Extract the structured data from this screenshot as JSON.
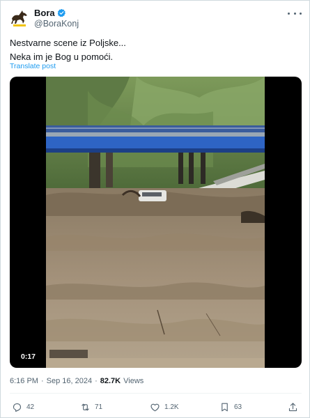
{
  "author": {
    "display_name": "Bora",
    "handle": "@BoraKonj",
    "verified": true,
    "avatar_icon": "horse-icon",
    "verified_icon": "verified-badge-icon"
  },
  "tweet": {
    "lines": [
      "Nestvarne scene iz Poljske...",
      "Neka im je Bog u pomoći."
    ],
    "translate_label": "Translate post"
  },
  "media": {
    "duration": "0:17"
  },
  "meta": {
    "time": "6:16 PM",
    "separator": "·",
    "date": "Sep 16, 2024",
    "views_count": "82.7K",
    "views_label": "Views"
  },
  "actions": {
    "replies": "42",
    "reposts": "71",
    "likes": "1.2K",
    "bookmarks": "63"
  },
  "colors": {
    "accent": "#1d9bf0",
    "text": "#0f1419",
    "muted": "#536471"
  }
}
